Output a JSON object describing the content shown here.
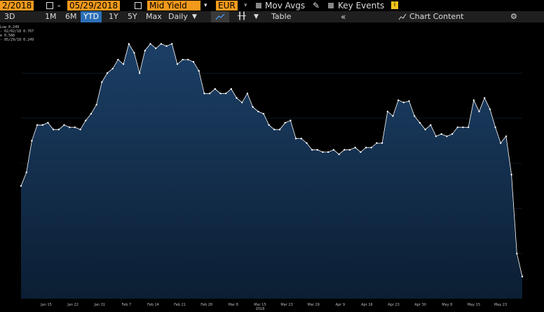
{
  "header": {
    "start_date": "2/2018",
    "end_date": "05/29/2018",
    "dash": "-",
    "field": "Mid Yield",
    "currency": "EUR",
    "mov_avgs": "Mov Avgs",
    "key_events": "Key Events",
    "info_badge": "i"
  },
  "toolbar": {
    "ranges": [
      "3D",
      "1M",
      "6M",
      "YTD",
      "1Y",
      "5Y",
      "Max"
    ],
    "active_range": "YTD",
    "frequency": "Daily",
    "table": "Table",
    "collapse": "«",
    "chart_content": "Chart Content"
  },
  "legend": {
    "lines": [
      "Low 0.249",
      "- 02/02/18 0.767",
      "e 0.588",
      "- 05/29/18 0.249"
    ]
  },
  "colors": {
    "accent_orange": "#f39a1c",
    "active_blue": "#2c6fb6",
    "area_top": "#1c3f66",
    "area_bottom": "#0b1e33",
    "line": "#ffffff"
  },
  "chart_data": {
    "type": "area",
    "title": "",
    "xlabel": "",
    "ylabel": "",
    "x_tick_labels": [
      "Jan 15",
      "Jan 22",
      "Jan 31",
      "Feb 7",
      "Feb 14",
      "Feb 21",
      "Feb 28",
      "Mar 8",
      "Mar 15",
      "Mar 23",
      "Mar 29",
      "Apr 9",
      "Apr 16",
      "Apr 23",
      "Apr 30",
      "May 8",
      "May 15",
      "May 23"
    ],
    "x_axis_year": "2018",
    "ylim": [
      0.2,
      0.8
    ],
    "values": [
      0.45,
      0.48,
      0.55,
      0.585,
      0.585,
      0.59,
      0.575,
      0.575,
      0.585,
      0.58,
      0.58,
      0.575,
      0.595,
      0.61,
      0.63,
      0.68,
      0.7,
      0.71,
      0.73,
      0.72,
      0.765,
      0.745,
      0.7,
      0.75,
      0.765,
      0.755,
      0.765,
      0.76,
      0.765,
      0.72,
      0.73,
      0.73,
      0.725,
      0.705,
      0.655,
      0.655,
      0.665,
      0.655,
      0.655,
      0.665,
      0.645,
      0.635,
      0.655,
      0.625,
      0.615,
      0.61,
      0.585,
      0.575,
      0.575,
      0.59,
      0.595,
      0.555,
      0.555,
      0.545,
      0.53,
      0.53,
      0.525,
      0.525,
      0.53,
      0.52,
      0.53,
      0.53,
      0.535,
      0.525,
      0.535,
      0.535,
      0.545,
      0.545,
      0.615,
      0.605,
      0.64,
      0.635,
      0.638,
      0.605,
      0.59,
      0.575,
      0.585,
      0.56,
      0.565,
      0.56,
      0.565,
      0.58,
      0.58,
      0.58,
      0.64,
      0.615,
      0.645,
      0.62,
      0.58,
      0.545,
      0.56,
      0.475,
      0.3,
      0.249
    ]
  }
}
